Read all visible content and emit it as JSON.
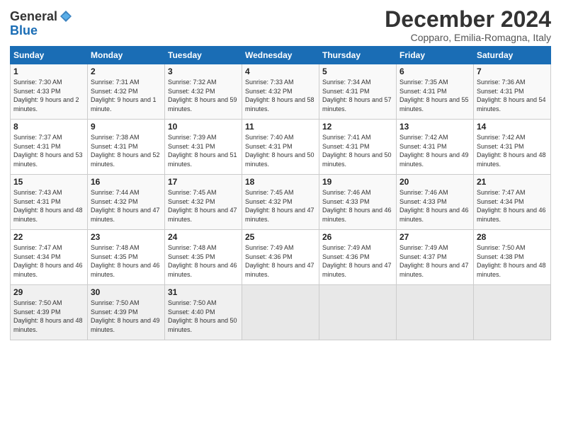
{
  "logo": {
    "line1": "General",
    "line2": "Blue"
  },
  "title": "December 2024",
  "subtitle": "Copparo, Emilia-Romagna, Italy",
  "days_header": [
    "Sunday",
    "Monday",
    "Tuesday",
    "Wednesday",
    "Thursday",
    "Friday",
    "Saturday"
  ],
  "weeks": [
    [
      {
        "day": "1",
        "sunrise": "Sunrise: 7:30 AM",
        "sunset": "Sunset: 4:33 PM",
        "daylight": "Daylight: 9 hours and 2 minutes."
      },
      {
        "day": "2",
        "sunrise": "Sunrise: 7:31 AM",
        "sunset": "Sunset: 4:32 PM",
        "daylight": "Daylight: 9 hours and 1 minute."
      },
      {
        "day": "3",
        "sunrise": "Sunrise: 7:32 AM",
        "sunset": "Sunset: 4:32 PM",
        "daylight": "Daylight: 8 hours and 59 minutes."
      },
      {
        "day": "4",
        "sunrise": "Sunrise: 7:33 AM",
        "sunset": "Sunset: 4:32 PM",
        "daylight": "Daylight: 8 hours and 58 minutes."
      },
      {
        "day": "5",
        "sunrise": "Sunrise: 7:34 AM",
        "sunset": "Sunset: 4:31 PM",
        "daylight": "Daylight: 8 hours and 57 minutes."
      },
      {
        "day": "6",
        "sunrise": "Sunrise: 7:35 AM",
        "sunset": "Sunset: 4:31 PM",
        "daylight": "Daylight: 8 hours and 55 minutes."
      },
      {
        "day": "7",
        "sunrise": "Sunrise: 7:36 AM",
        "sunset": "Sunset: 4:31 PM",
        "daylight": "Daylight: 8 hours and 54 minutes."
      }
    ],
    [
      {
        "day": "8",
        "sunrise": "Sunrise: 7:37 AM",
        "sunset": "Sunset: 4:31 PM",
        "daylight": "Daylight: 8 hours and 53 minutes."
      },
      {
        "day": "9",
        "sunrise": "Sunrise: 7:38 AM",
        "sunset": "Sunset: 4:31 PM",
        "daylight": "Daylight: 8 hours and 52 minutes."
      },
      {
        "day": "10",
        "sunrise": "Sunrise: 7:39 AM",
        "sunset": "Sunset: 4:31 PM",
        "daylight": "Daylight: 8 hours and 51 minutes."
      },
      {
        "day": "11",
        "sunrise": "Sunrise: 7:40 AM",
        "sunset": "Sunset: 4:31 PM",
        "daylight": "Daylight: 8 hours and 50 minutes."
      },
      {
        "day": "12",
        "sunrise": "Sunrise: 7:41 AM",
        "sunset": "Sunset: 4:31 PM",
        "daylight": "Daylight: 8 hours and 50 minutes."
      },
      {
        "day": "13",
        "sunrise": "Sunrise: 7:42 AM",
        "sunset": "Sunset: 4:31 PM",
        "daylight": "Daylight: 8 hours and 49 minutes."
      },
      {
        "day": "14",
        "sunrise": "Sunrise: 7:42 AM",
        "sunset": "Sunset: 4:31 PM",
        "daylight": "Daylight: 8 hours and 48 minutes."
      }
    ],
    [
      {
        "day": "15",
        "sunrise": "Sunrise: 7:43 AM",
        "sunset": "Sunset: 4:31 PM",
        "daylight": "Daylight: 8 hours and 48 minutes."
      },
      {
        "day": "16",
        "sunrise": "Sunrise: 7:44 AM",
        "sunset": "Sunset: 4:32 PM",
        "daylight": "Daylight: 8 hours and 47 minutes."
      },
      {
        "day": "17",
        "sunrise": "Sunrise: 7:45 AM",
        "sunset": "Sunset: 4:32 PM",
        "daylight": "Daylight: 8 hours and 47 minutes."
      },
      {
        "day": "18",
        "sunrise": "Sunrise: 7:45 AM",
        "sunset": "Sunset: 4:32 PM",
        "daylight": "Daylight: 8 hours and 47 minutes."
      },
      {
        "day": "19",
        "sunrise": "Sunrise: 7:46 AM",
        "sunset": "Sunset: 4:33 PM",
        "daylight": "Daylight: 8 hours and 46 minutes."
      },
      {
        "day": "20",
        "sunrise": "Sunrise: 7:46 AM",
        "sunset": "Sunset: 4:33 PM",
        "daylight": "Daylight: 8 hours and 46 minutes."
      },
      {
        "day": "21",
        "sunrise": "Sunrise: 7:47 AM",
        "sunset": "Sunset: 4:34 PM",
        "daylight": "Daylight: 8 hours and 46 minutes."
      }
    ],
    [
      {
        "day": "22",
        "sunrise": "Sunrise: 7:47 AM",
        "sunset": "Sunset: 4:34 PM",
        "daylight": "Daylight: 8 hours and 46 minutes."
      },
      {
        "day": "23",
        "sunrise": "Sunrise: 7:48 AM",
        "sunset": "Sunset: 4:35 PM",
        "daylight": "Daylight: 8 hours and 46 minutes."
      },
      {
        "day": "24",
        "sunrise": "Sunrise: 7:48 AM",
        "sunset": "Sunset: 4:35 PM",
        "daylight": "Daylight: 8 hours and 46 minutes."
      },
      {
        "day": "25",
        "sunrise": "Sunrise: 7:49 AM",
        "sunset": "Sunset: 4:36 PM",
        "daylight": "Daylight: 8 hours and 47 minutes."
      },
      {
        "day": "26",
        "sunrise": "Sunrise: 7:49 AM",
        "sunset": "Sunset: 4:36 PM",
        "daylight": "Daylight: 8 hours and 47 minutes."
      },
      {
        "day": "27",
        "sunrise": "Sunrise: 7:49 AM",
        "sunset": "Sunset: 4:37 PM",
        "daylight": "Daylight: 8 hours and 47 minutes."
      },
      {
        "day": "28",
        "sunrise": "Sunrise: 7:50 AM",
        "sunset": "Sunset: 4:38 PM",
        "daylight": "Daylight: 8 hours and 48 minutes."
      }
    ],
    [
      {
        "day": "29",
        "sunrise": "Sunrise: 7:50 AM",
        "sunset": "Sunset: 4:39 PM",
        "daylight": "Daylight: 8 hours and 48 minutes."
      },
      {
        "day": "30",
        "sunrise": "Sunrise: 7:50 AM",
        "sunset": "Sunset: 4:39 PM",
        "daylight": "Daylight: 8 hours and 49 minutes."
      },
      {
        "day": "31",
        "sunrise": "Sunrise: 7:50 AM",
        "sunset": "Sunset: 4:40 PM",
        "daylight": "Daylight: 8 hours and 50 minutes."
      },
      null,
      null,
      null,
      null
    ]
  ]
}
